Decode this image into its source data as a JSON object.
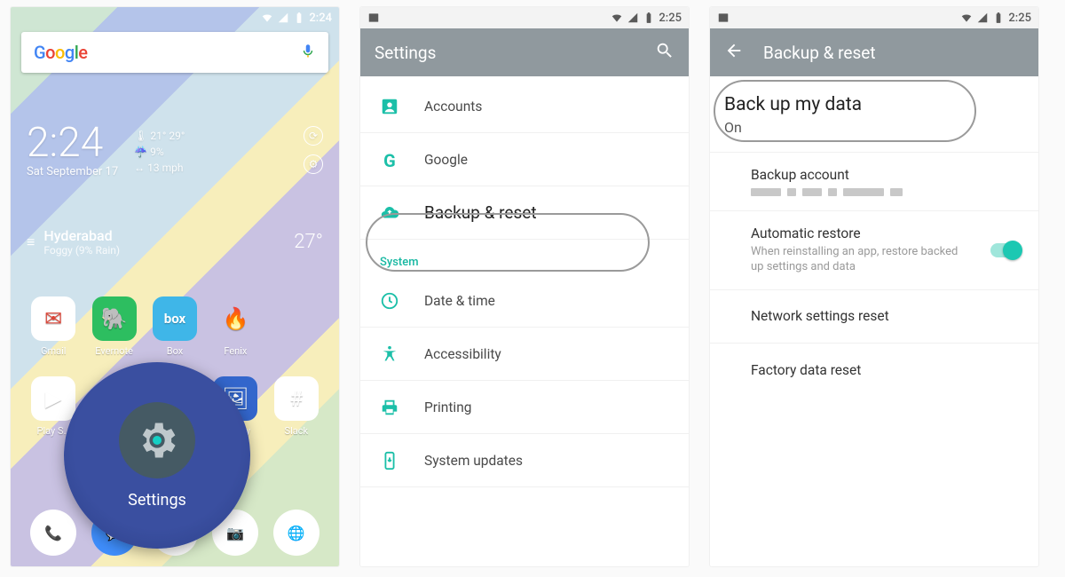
{
  "screen1": {
    "status_time": "2:24",
    "search_logo": "Google",
    "clock_time": "2:24",
    "clock_date": "Sat September 17",
    "w_hi_lo": "21° 29°",
    "w_rain": "9%",
    "w_wind": "13 mph",
    "city": "Hyderabad",
    "cond": "Foggy (9% Rain)",
    "temp": "27°",
    "apps": [
      "Gmail",
      "Evernote",
      "Box",
      "Fenix",
      "",
      "Play S…",
      "",
      "",
      "Gallery",
      "Slack"
    ],
    "zoom_label": "Settings"
  },
  "screen2": {
    "status_time": "2:25",
    "title": "Settings",
    "rows1": [
      "Accounts",
      "Google",
      "Backup & reset"
    ],
    "section": "System",
    "rows2": [
      "Date & time",
      "Accessibility",
      "Printing",
      "System updates"
    ]
  },
  "screen3": {
    "status_time": "2:25",
    "title": "Backup & reset",
    "r1_title": "Back up my data",
    "r1_sub": "On",
    "r2_title": "Backup account",
    "r3_title": "Automatic restore",
    "r3_sub": "When reinstalling an app, restore backed up settings and data",
    "r4_title": "Network settings reset",
    "r5_title": "Factory data reset"
  }
}
